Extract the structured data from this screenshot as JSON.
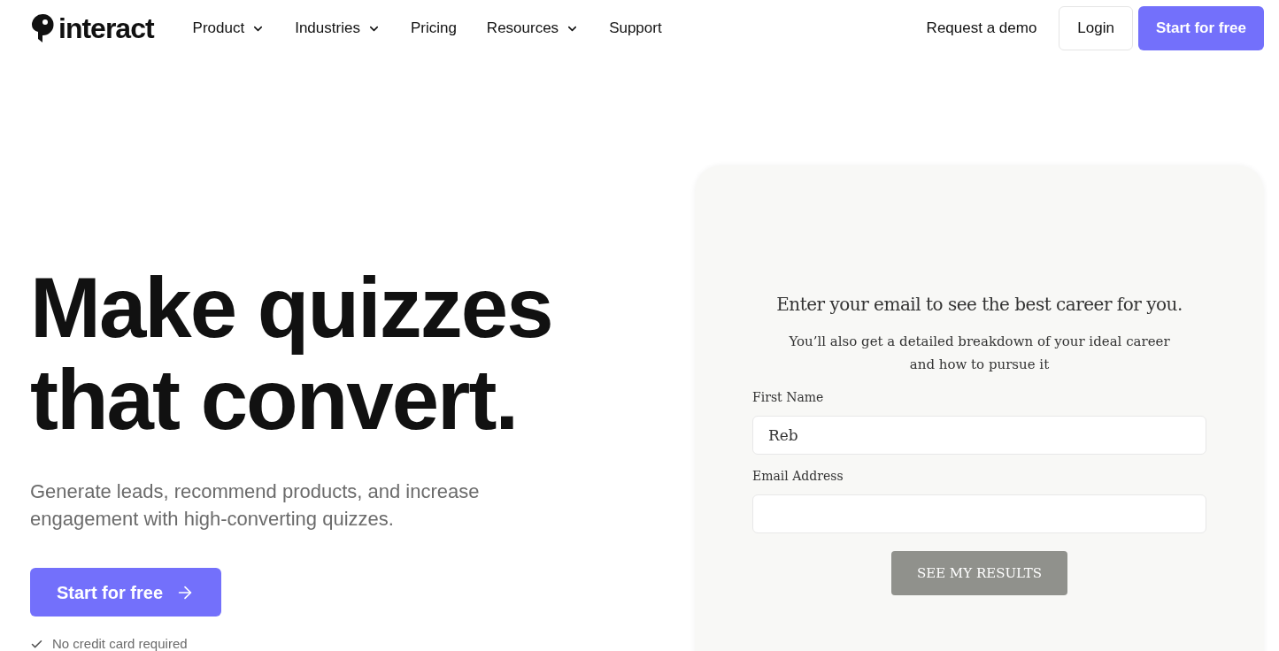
{
  "header": {
    "logo": "interact",
    "nav": [
      {
        "label": "Product",
        "has_menu": true
      },
      {
        "label": "Industries",
        "has_menu": true
      },
      {
        "label": "Pricing",
        "has_menu": false
      },
      {
        "label": "Resources",
        "has_menu": true
      },
      {
        "label": "Support",
        "has_menu": false
      }
    ],
    "demo_link": "Request a demo",
    "login": "Login",
    "cta": "Start for free"
  },
  "hero": {
    "headline_lines": [
      "Make quizzes",
      "that convert."
    ],
    "subtitle": "Generate leads, recommend products, and increase engagement with high-converting quizzes.",
    "cta": "Start for free",
    "note": "No credit card required"
  },
  "quiz_card": {
    "title": "Enter your email to see the best career for you.",
    "subtitle": "You’ll also get a detailed breakdown of your ideal career and how to pursue it",
    "fields": [
      {
        "label": "First Name",
        "value": "Reb"
      },
      {
        "label": "Email Address"
      }
    ],
    "button": "SEE MY RESULTS"
  }
}
